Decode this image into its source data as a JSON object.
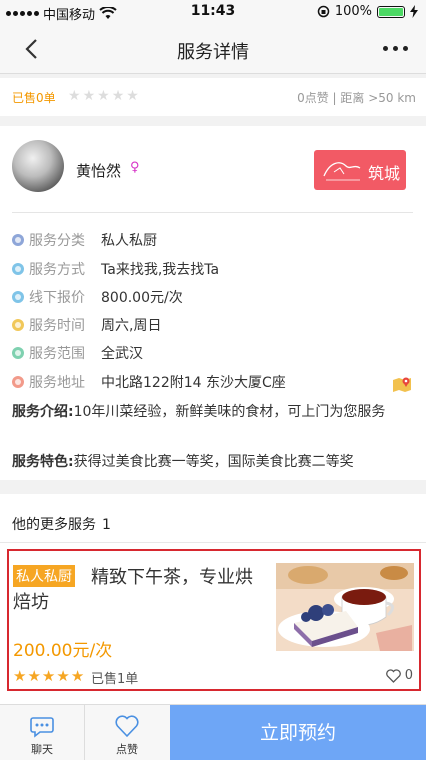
{
  "status_bar": {
    "carrier": "中国移动",
    "time": "11:43",
    "battery": "100%",
    "battery_level": 1.0
  },
  "nav": {
    "title": "服务详情"
  },
  "stats": {
    "sold": "已售0单",
    "rating": 0,
    "likes_distance": "0点赞 | 距离 >50 km"
  },
  "provider": {
    "name": "黄怡然",
    "badge_label": "筑城"
  },
  "info": [
    {
      "label": "服务分类",
      "value": "私人私厨",
      "color": "#8ea6d8"
    },
    {
      "label": "服务方式",
      "value": "Ta来找我,我去找Ta",
      "color": "#7fc4e8"
    },
    {
      "label": "线下报价",
      "value": "800.00元/次",
      "color": "#7fc4e8"
    },
    {
      "label": "服务时间",
      "value": "周六,周日",
      "color": "#f1c85a"
    },
    {
      "label": "服务范围",
      "value": "全武汉",
      "color": "#7fd1b0"
    },
    {
      "label": "服务地址",
      "value": "中北路122附14 东沙大厦C座",
      "color": "#f29a8a"
    }
  ],
  "description": {
    "intro_label": "服务介绍:",
    "intro_text": "10年川菜经验，新鲜美味的食材，可上门为您服务",
    "feature_label": "服务特色:",
    "feature_text": "获得过美食比赛一等奖，国际美食比赛二等奖"
  },
  "more_services": {
    "title": "他的更多服务",
    "count": "1",
    "items": [
      {
        "tag": "私人私厨",
        "title": "精致下午茶，专业烘焙坊",
        "price": "200.00元/次",
        "rating": 5,
        "sold": "已售1单",
        "likes": "0"
      }
    ]
  },
  "bottom_bar": {
    "chat_label": "聊天",
    "like_label": "点赞",
    "book_label": "立即预约"
  },
  "colors": {
    "accent_orange": "#f39800",
    "book_button": "#6ea6f6",
    "highlight_border": "#d7282f",
    "badge_bg": "#f25a65"
  }
}
